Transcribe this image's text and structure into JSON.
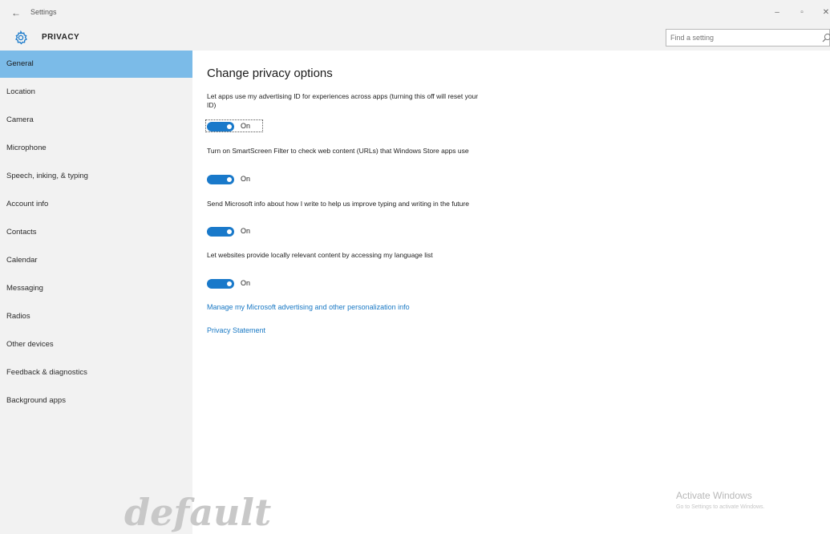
{
  "titlebar": {
    "back_glyph": "←",
    "title": "Settings",
    "minimize_glyph": "–",
    "maximize_glyph": "▫",
    "close_glyph": "✕"
  },
  "header": {
    "title": "PRIVACY",
    "icon": "gear-icon",
    "search_placeholder": "Find a setting"
  },
  "sidebar": {
    "active_index": 0,
    "items": [
      {
        "label": "General"
      },
      {
        "label": "Location"
      },
      {
        "label": "Camera"
      },
      {
        "label": "Microphone"
      },
      {
        "label": "Speech, inking, & typing"
      },
      {
        "label": "Account info"
      },
      {
        "label": "Contacts"
      },
      {
        "label": "Calendar"
      },
      {
        "label": "Messaging"
      },
      {
        "label": "Radios"
      },
      {
        "label": "Other devices"
      },
      {
        "label": "Feedback & diagnostics"
      },
      {
        "label": "Background apps"
      }
    ]
  },
  "main": {
    "title": "Change privacy options",
    "settings": [
      {
        "description": "Let apps use my advertising ID for experiences across apps (turning this off will reset your ID)",
        "state": "On",
        "on": true
      },
      {
        "description": "Turn on SmartScreen Filter to check web content (URLs) that Windows Store apps use",
        "state": "On",
        "on": true
      },
      {
        "description": "Send Microsoft info about how I write to help us improve typing and writing in the future",
        "state": "On",
        "on": true
      },
      {
        "description": "Let websites provide locally relevant content by accessing my language list",
        "state": "On",
        "on": true
      }
    ],
    "links": [
      "Manage my Microsoft advertising and other personalization info",
      "Privacy Statement"
    ]
  },
  "watermark": {
    "activate_title": "Activate Windows",
    "activate_sub": "Go to Settings to activate Windows.",
    "overlay_text": "default"
  },
  "colors": {
    "accent": "#1979ca",
    "active_nav": "#7bbbe8",
    "link": "#1878c4",
    "chrome_bg": "#f2f2f2"
  }
}
